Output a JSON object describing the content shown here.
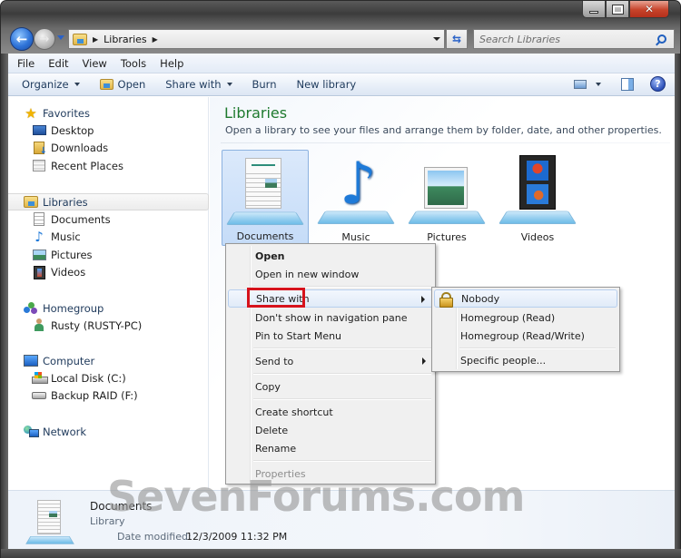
{
  "window": {
    "caption_buttons": {
      "minimize": "minimize",
      "maximize": "maximize",
      "close": "✕"
    }
  },
  "nav": {
    "back_glyph": "←",
    "forward_glyph": "→",
    "address_crumbs": [
      "Libraries"
    ],
    "refresh_glyph": "⇆",
    "search_placeholder": "Search Libraries"
  },
  "menu_bar": {
    "items": [
      "File",
      "Edit",
      "View",
      "Tools",
      "Help"
    ]
  },
  "command_bar": {
    "organize": "Organize",
    "open": "Open",
    "share_with": "Share with",
    "burn": "Burn",
    "new_library": "New library",
    "help_glyph": "?"
  },
  "nav_pane": {
    "favorites": {
      "label": "Favorites",
      "items": [
        "Desktop",
        "Downloads",
        "Recent Places"
      ]
    },
    "libraries": {
      "label": "Libraries",
      "items": [
        "Documents",
        "Music",
        "Pictures",
        "Videos"
      ]
    },
    "homegroup": {
      "label": "Homegroup",
      "items": [
        "Rusty (RUSTY-PC)"
      ]
    },
    "computer": {
      "label": "Computer",
      "items": [
        "Local Disk (C:)",
        "Backup RAID (F:)"
      ]
    },
    "network": {
      "label": "Network"
    }
  },
  "content": {
    "title": "Libraries",
    "subtitle": "Open a library to see your files and arrange them by folder, date, and other properties.",
    "libraries": [
      {
        "name": "Documents",
        "selected": true
      },
      {
        "name": "Music",
        "selected": false
      },
      {
        "name": "Pictures",
        "selected": false
      },
      {
        "name": "Videos",
        "selected": false
      }
    ]
  },
  "context_menu": {
    "open": "Open",
    "open_new_window": "Open in new window",
    "share_with": "Share with",
    "dont_show": "Don't show in navigation pane",
    "pin_start": "Pin to Start Menu",
    "send_to": "Send to",
    "copy": "Copy",
    "create_shortcut": "Create shortcut",
    "delete": "Delete",
    "rename": "Rename",
    "properties": "Properties"
  },
  "share_submenu": {
    "nobody": "Nobody",
    "homegroup_read": "Homegroup (Read)",
    "homegroup_readwrite": "Homegroup (Read/Write)",
    "specific_people": "Specific people..."
  },
  "details_pane": {
    "name": "Documents",
    "type": "Library",
    "date_label": "Date modified:",
    "date_value": "12/3/2009 11:32 PM"
  },
  "watermark": "SevenForums.com",
  "colors": {
    "title_green": "#1e7a2e",
    "highlight_red": "#d6131c",
    "selection_blue": "#c5dcf8"
  }
}
